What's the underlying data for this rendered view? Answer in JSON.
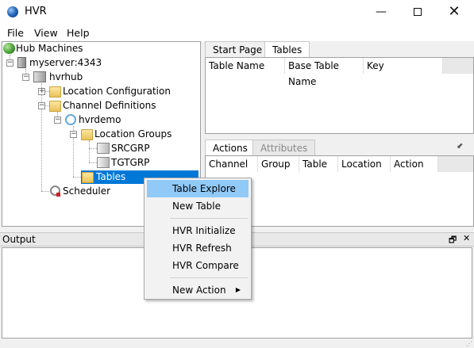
{
  "window": {
    "title": "HVR",
    "minimize": "—",
    "close": "✕"
  },
  "menu": [
    "File",
    "View",
    "Help"
  ],
  "tree": {
    "root": "Hub Machines",
    "server": "myserver:4343",
    "hub": "hvrhub",
    "location_configuration": "Location Configuration",
    "channel_definitions": "Channel Definitions",
    "channel": "hvrdemo",
    "location_groups": "Location Groups",
    "group1": "SRCGRP",
    "group2": "TGTGRP",
    "tables": "Tables",
    "scheduler": "Scheduler"
  },
  "top_tabs": [
    "Start Page",
    "Tables"
  ],
  "tables_columns": [
    "Table Name",
    "Base Table Name",
    "Key"
  ],
  "bottom_tabs": [
    "Actions",
    "Attributes"
  ],
  "actions_columns": [
    "Channel",
    "Group",
    "Table",
    "Location",
    "Action"
  ],
  "output": {
    "label": "Output",
    "restore": "🗗",
    "close": "✕"
  },
  "context_menu": {
    "items": [
      "Table Explore",
      "New Table",
      "HVR Initialize",
      "HVR Refresh",
      "HVR Compare",
      "New Action"
    ],
    "highlighted": "Table Explore",
    "submenu_arrow": "▶"
  },
  "colors": {
    "selection": "#0078d7",
    "menu_highlight": "#91c9f7"
  }
}
